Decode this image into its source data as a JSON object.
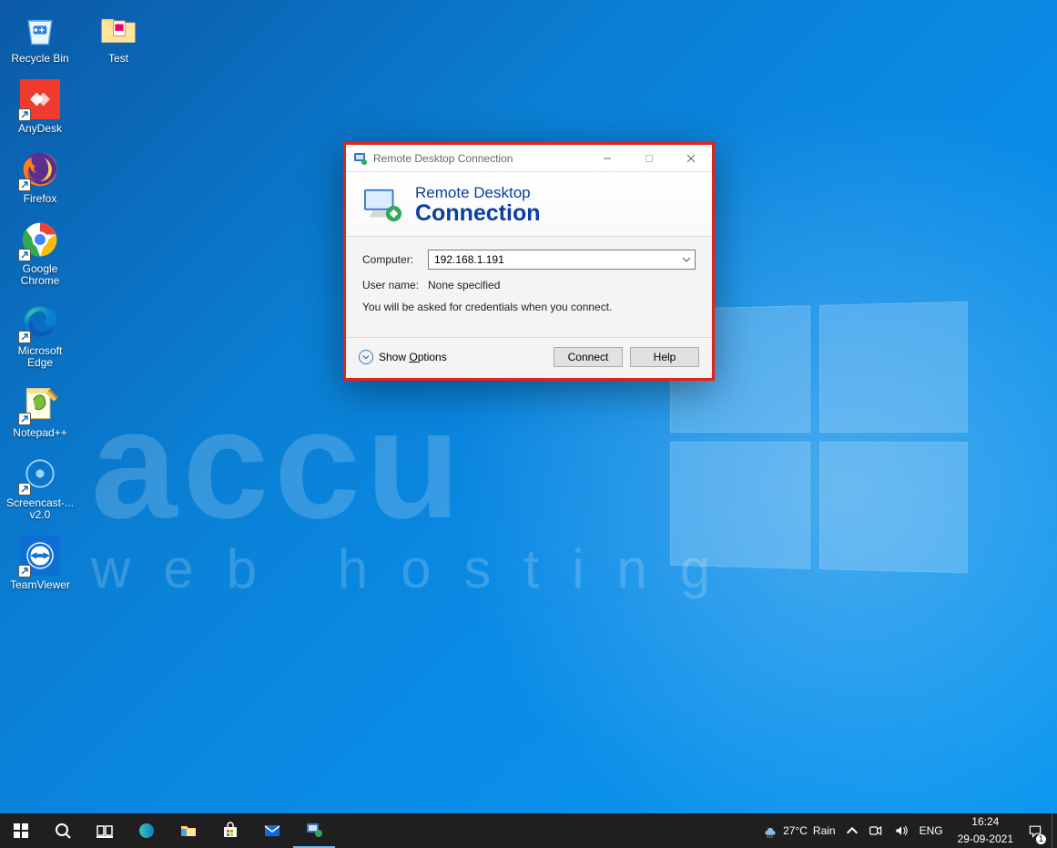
{
  "desktop_icons": {
    "recycle_bin": "Recycle Bin",
    "test": "Test",
    "anydesk": "AnyDesk",
    "firefox": "Firefox",
    "chrome": "Google\nChrome",
    "edge": "Microsoft\nEdge",
    "notepadpp": "Notepad++",
    "screencast": "Screencast-...\nv2.0",
    "teamviewer": "TeamViewer"
  },
  "rdp": {
    "title": "Remote Desktop Connection",
    "banner_line1": "Remote Desktop",
    "banner_line2": "Connection",
    "computer_label": "Computer:",
    "computer_value": "192.168.1.191",
    "username_label": "User name:",
    "username_value": "None specified",
    "hint": "You will be asked for credentials when you connect.",
    "show_options": "Show Options",
    "connect_btn": "Connect",
    "help_btn": "Help"
  },
  "taskbar": {
    "weather_temp": "27°C",
    "weather_cond": "Rain",
    "lang": "ENG",
    "time": "16:24",
    "date": "29-09-2021",
    "notif_count": "1"
  },
  "watermark": {
    "line1": "accu",
    "line2": "web  hosting"
  }
}
